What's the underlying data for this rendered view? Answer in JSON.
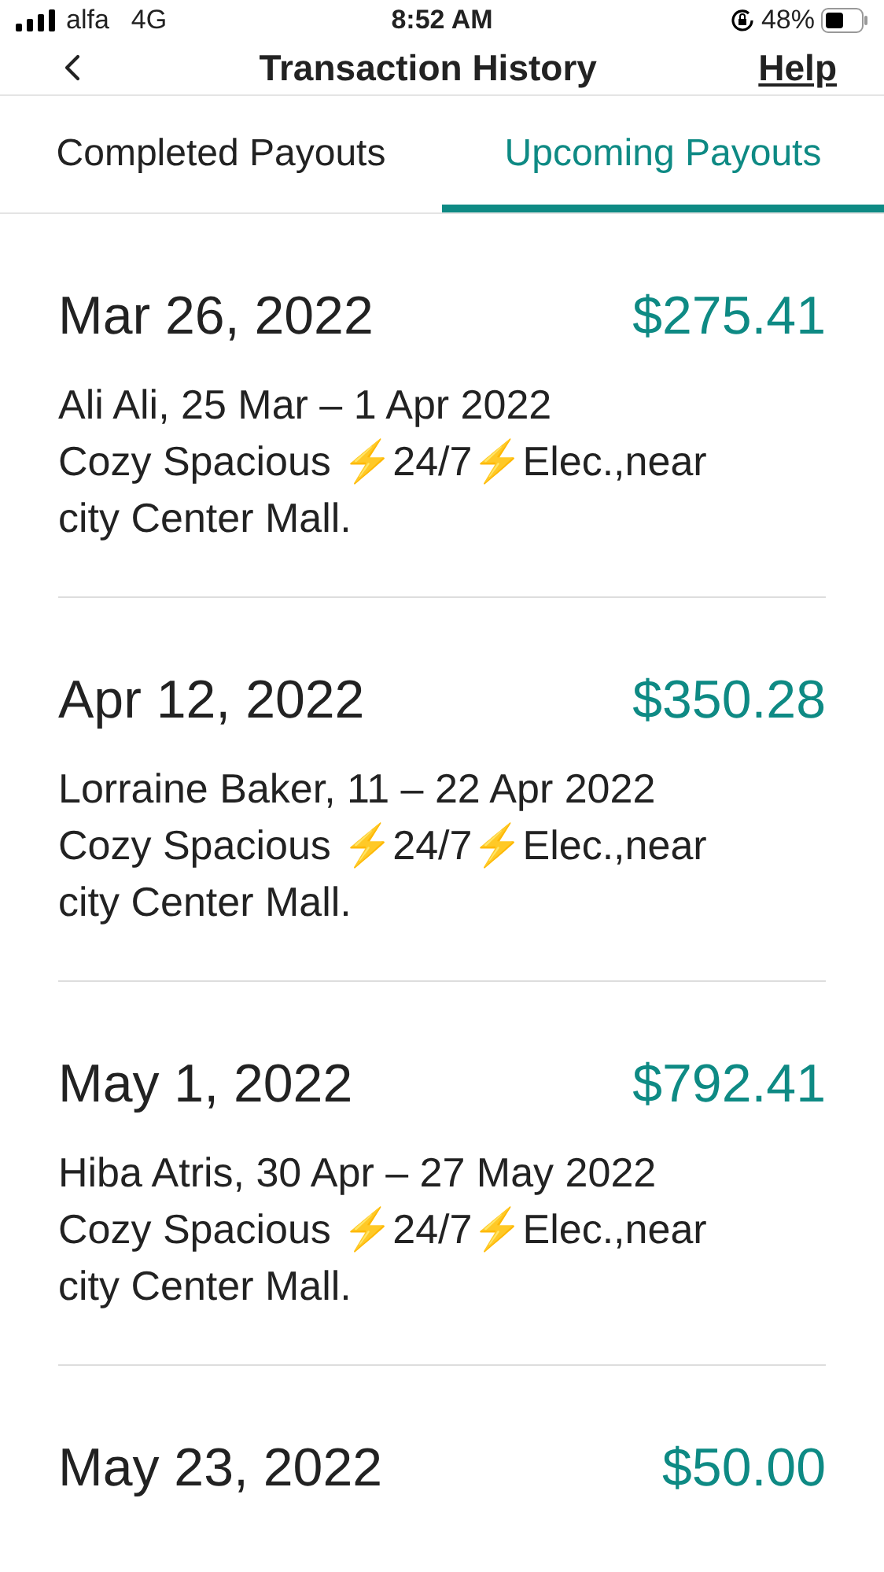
{
  "status_bar": {
    "carrier": "alfa",
    "network": "4G",
    "time": "8:52 AM",
    "battery": "48%"
  },
  "header": {
    "title": "Transaction History",
    "help": "Help"
  },
  "tabs": [
    {
      "label": "Completed Payouts",
      "selected": false
    },
    {
      "label": "Upcoming Payouts",
      "selected": true
    }
  ],
  "payouts": [
    {
      "date": "Mar 26, 2022",
      "amount": "$275.41",
      "guest": "Ali Ali, 25 Mar – 1 Apr 2022",
      "listing": "Cozy Spacious ⚡24/7⚡Elec.,near city Center Mall."
    },
    {
      "date": "Apr 12, 2022",
      "amount": "$350.28",
      "guest": "Lorraine Baker, 11 – 22 Apr 2022",
      "listing": "Cozy Spacious ⚡24/7⚡Elec.,near city Center Mall."
    },
    {
      "date": "May 1, 2022",
      "amount": "$792.41",
      "guest": "Hiba Atris, 30 Apr – 27 May 2022",
      "listing": "Cozy Spacious ⚡24/7⚡Elec.,near city Center Mall."
    },
    {
      "date": "May 23, 2022",
      "amount": "$50.00"
    }
  ]
}
